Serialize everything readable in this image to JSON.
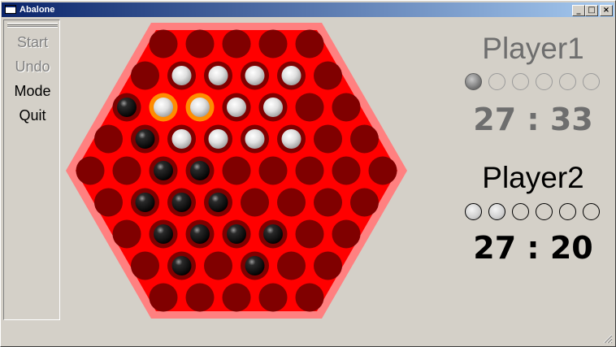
{
  "window": {
    "title": "Abalone",
    "minimize_label": "_",
    "maximize_label": "□",
    "close_label": "×"
  },
  "menu": {
    "items": [
      {
        "label": "Start",
        "enabled": false
      },
      {
        "label": "Undo",
        "enabled": false
      },
      {
        "label": "Mode",
        "enabled": true
      },
      {
        "label": "Quit",
        "enabled": true
      }
    ]
  },
  "board": {
    "rows": [
      ".....",
      ".WWWW.",
      "BSSWW..",
      ".BWWWW..",
      "..BB.....",
      ".BBB....",
      ".BBBB..",
      ".B.B..",
      "....."
    ],
    "legend": {
      ".": "empty",
      "W": "white",
      "B": "black",
      "S": "white-selected"
    },
    "colors": {
      "board": "#ff0000",
      "border": "#ff8080",
      "hole": "#800000",
      "selection": "#ff8c00"
    }
  },
  "players": [
    {
      "name": "Player1",
      "score": "27 : 33",
      "captures": 1,
      "capture_slots": 6,
      "active": false
    },
    {
      "name": "Player2",
      "score": "27 : 20",
      "captures": 2,
      "capture_slots": 6,
      "active": true
    }
  ]
}
